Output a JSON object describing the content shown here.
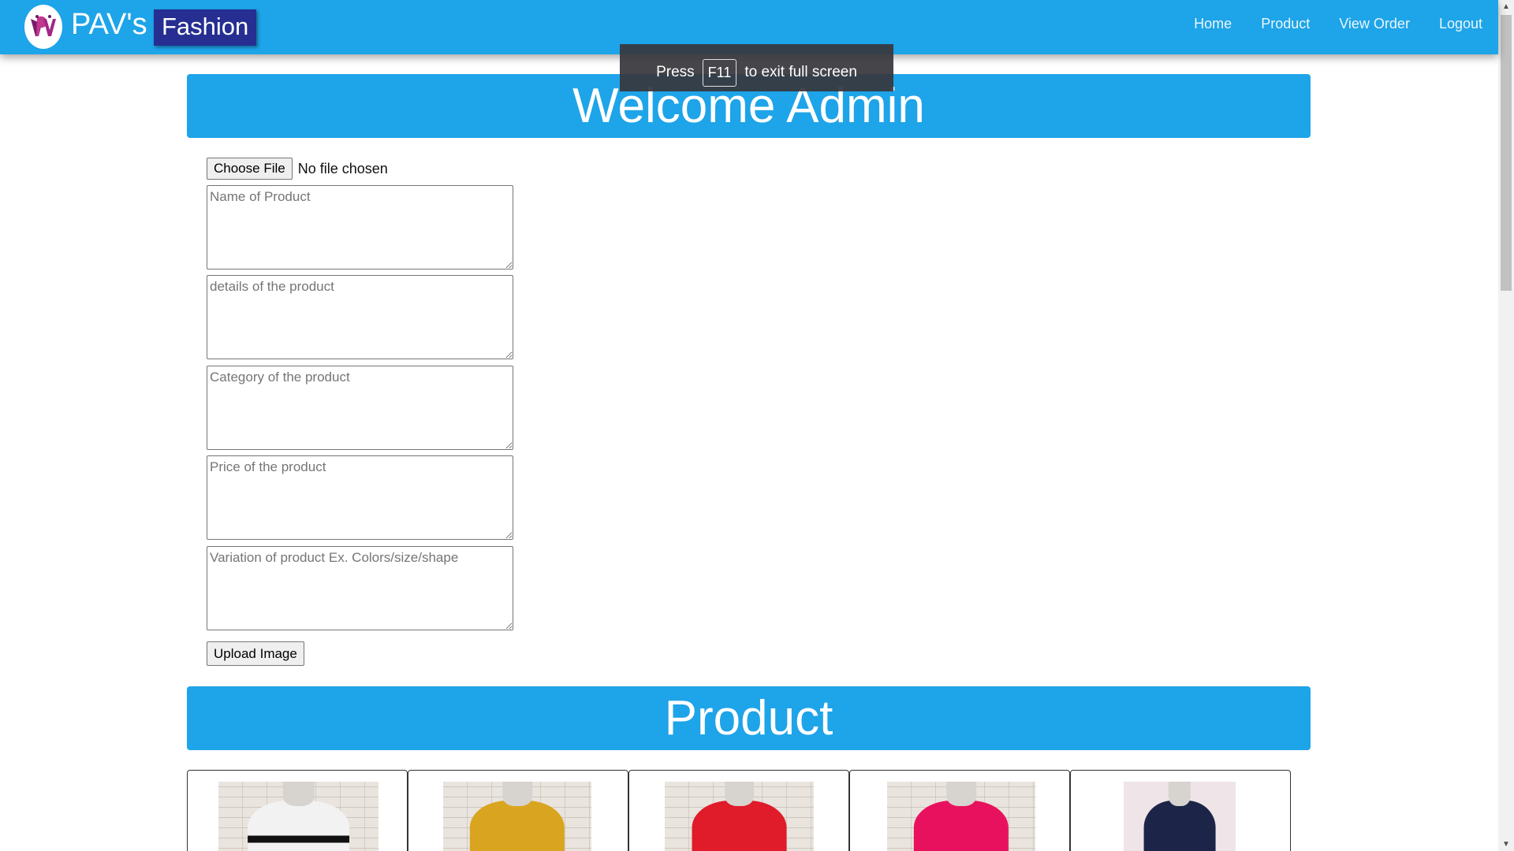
{
  "brand": {
    "name": "PAV's",
    "badge": "Fashion"
  },
  "nav": {
    "items": [
      {
        "label": "Home"
      },
      {
        "label": "Product"
      },
      {
        "label": "View Order"
      },
      {
        "label": "Logout"
      }
    ]
  },
  "fullscreen_toast": {
    "prefix": "Press",
    "key": "F11",
    "suffix": "to exit full screen"
  },
  "welcome": {
    "title": "Welcome Admin"
  },
  "form": {
    "file_button": "Choose File",
    "file_status": "No file chosen",
    "fields": {
      "name_placeholder": "Name of Product",
      "details_placeholder": "details of the product",
      "category_placeholder": "Category of the product",
      "price_placeholder": "Price of the product",
      "variation_placeholder": "Variation of product Ex. Colors/size/shape"
    },
    "upload_button": "Upload Image"
  },
  "products": {
    "title": "Product",
    "cards": [
      {
        "dress_color": "#f2f2f2",
        "belt_color": "#111111"
      },
      {
        "dress_color": "#d9a520",
        "belt_color": ""
      },
      {
        "dress_color": "#e01b2a",
        "belt_color": ""
      },
      {
        "dress_color": "#e8115d",
        "belt_color": ""
      },
      {
        "dress_color": "#1c2447",
        "belt_color": ""
      }
    ]
  },
  "colors": {
    "primary": "#1ea4e8",
    "badge": "#262e91",
    "toast": "#37373c"
  }
}
